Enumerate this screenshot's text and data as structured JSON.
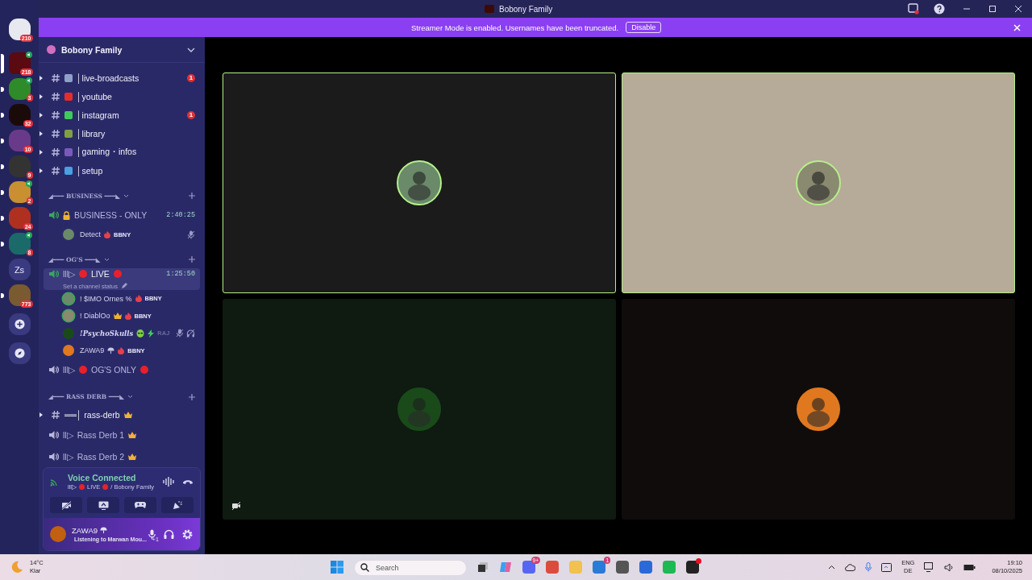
{
  "titlebar": {
    "title": "Bobony Family"
  },
  "banner": {
    "text": "Streamer Mode is enabled. Usernames have been truncated.",
    "button": "Disable"
  },
  "servers": [
    {
      "badge": "210",
      "voice": false,
      "selected": false
    },
    {
      "badge": "218",
      "voice": true,
      "selected": true
    },
    {
      "badge": "3",
      "voice": true,
      "selected": false,
      "unread": true
    },
    {
      "badge": "32",
      "voice": false,
      "selected": false,
      "unread": true
    },
    {
      "badge": "10",
      "voice": false,
      "selected": false,
      "unread": true
    },
    {
      "badge": "9",
      "voice": false,
      "selected": false,
      "unread": true
    },
    {
      "badge": "2",
      "voice": true,
      "selected": false,
      "unread": true
    },
    {
      "badge": "24",
      "voice": false,
      "selected": false,
      "unread": true
    },
    {
      "badge": "8",
      "voice": true,
      "selected": false,
      "unread": true
    },
    {
      "label": "Zs",
      "selected": false
    },
    {
      "badge": "773",
      "voice": false,
      "selected": false,
      "unread": true
    }
  ],
  "server_name": "Bobony Family",
  "channels": [
    {
      "kind": "text",
      "name": "│live-broadcasts",
      "color": "#8fa0c8",
      "badge": "1"
    },
    {
      "kind": "text",
      "name": "│youtube",
      "color": "#e52d2d"
    },
    {
      "kind": "text",
      "name": "│instagram",
      "color": "#3ecb5a",
      "badge": "1"
    },
    {
      "kind": "text",
      "name": "│library",
      "color": "#7fa040"
    },
    {
      "kind": "text",
      "name": "│gaming・infos",
      "color": "#7a5ab8"
    },
    {
      "kind": "text",
      "name": "│setup",
      "color": "#4aa0e0"
    },
    {
      "kind": "category",
      "name": "◢━━━ BUSINESS ━━━◣"
    },
    {
      "kind": "voice",
      "name": "BUSINESS - ONLY",
      "lock": true,
      "active": true,
      "time": "2:40:25",
      "selected": false,
      "members": [
        {
          "name": "Detect",
          "tag": "BBNY",
          "muted": true,
          "speaking": false
        }
      ]
    },
    {
      "kind": "category",
      "name": "◢━━━ OG'S ━━━◣"
    },
    {
      "kind": "voice",
      "prefix": "lll▷",
      "name": "LIVE",
      "red_dots": true,
      "active": true,
      "time": "1:25:50",
      "status": "Set a channel status",
      "selected": true,
      "members": [
        {
          "name": "! $IMO Ornes %",
          "tag": "BBNY",
          "speaking": true
        },
        {
          "name": "! DiablOo",
          "crown": true,
          "tag": "BBNY",
          "speaking": true
        },
        {
          "name": "!PsychoSkulls",
          "italic": true,
          "alien": true,
          "tag": "RAJ",
          "bolt": true,
          "muted": true,
          "deafened": true,
          "speaking": false
        },
        {
          "name": "ZAWA9",
          "emblem": true,
          "tag": "BBNY",
          "speaking": false
        }
      ]
    },
    {
      "kind": "voice",
      "prefix": "lll▷",
      "name": "OG'S ONLY",
      "red_dots": true,
      "active": false,
      "selected": false
    },
    {
      "kind": "category",
      "name": "◢━━━ RASS DERB ━━━◣"
    },
    {
      "kind": "text",
      "name": "══│ rass-derb",
      "crown": true
    },
    {
      "kind": "voice",
      "prefix": "ll▷",
      "name": "Rass Derb 1",
      "crown": true,
      "active": false,
      "selected": false
    },
    {
      "kind": "voice",
      "prefix": "ll▷",
      "name": "Rass Derb 2",
      "crown": true,
      "active": false,
      "selected": false
    }
  ],
  "voice_panel": {
    "title": "Voice Connected",
    "prefix": "lll▷",
    "channel": "LIVE",
    "server": "/ Bobony Family"
  },
  "user": {
    "name": "ZAWA9",
    "activity": "Listening to Marwan Mou...",
    "extra": "+1"
  },
  "tiles": [
    {
      "color": "#1b1b1b",
      "speaking": true,
      "video_off_icon": false
    },
    {
      "color": "#b6aa98",
      "speaking": true,
      "video_off_icon": false
    },
    {
      "color": "#0f1a11",
      "speaking": false,
      "video_off_icon": true
    },
    {
      "color": "#100c0c",
      "speaking": false,
      "video_off_icon": false
    }
  ],
  "taskbar": {
    "temperature": "14°C",
    "weather": "Klar",
    "search_placeholder": "Search",
    "apps": [
      {
        "badge": "9+",
        "dot": false
      },
      {
        "dot": false
      },
      {
        "dot": false
      },
      {
        "badge": "1",
        "dot": false
      },
      {
        "dot": false
      },
      {
        "dot": false
      },
      {
        "dot": false
      },
      {
        "dot": true
      }
    ],
    "lang": "ENG",
    "layout": "DE",
    "time": "19:10",
    "date": "08/10/2025"
  }
}
